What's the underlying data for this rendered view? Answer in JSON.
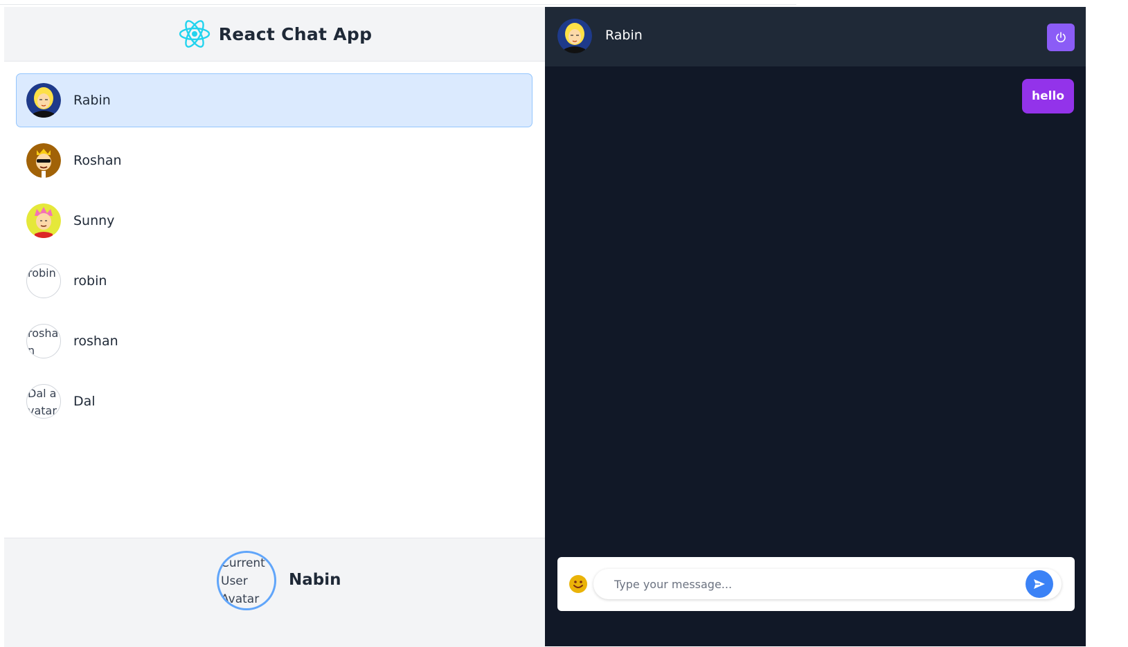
{
  "app": {
    "title": "React Chat App"
  },
  "contacts": [
    {
      "name": "Rabin",
      "avatar": "blonde-avatar",
      "active": true
    },
    {
      "name": "Roshan",
      "avatar": "crown-sunglasses-avatar",
      "active": false
    },
    {
      "name": "Sunny",
      "avatar": "pink-hair-avatar",
      "active": false
    },
    {
      "name": "robin",
      "avatar_alt": "robin",
      "active": false
    },
    {
      "name": "roshan",
      "avatar_alt": "roshan",
      "active": false
    },
    {
      "name": "Dal",
      "avatar_alt": "Dal avatar",
      "active": false
    }
  ],
  "current_user": {
    "name": "Nabin",
    "avatar_alt": "Current User Avatar"
  },
  "chat": {
    "contact_name": "Rabin",
    "messages": [
      {
        "text": "hello",
        "from": "me"
      }
    ]
  },
  "composer": {
    "placeholder": "Type your message..."
  },
  "colors": {
    "accent": "#9333ea",
    "power_button": "#8b5cf6",
    "send_button": "#3b82f6",
    "active_contact": "#dbeafe",
    "chat_background": "#111827"
  },
  "icons": {
    "logo": "react-atom-icon",
    "logout": "power-icon",
    "emoji": "smiley-icon",
    "send": "send-arrow-icon"
  }
}
